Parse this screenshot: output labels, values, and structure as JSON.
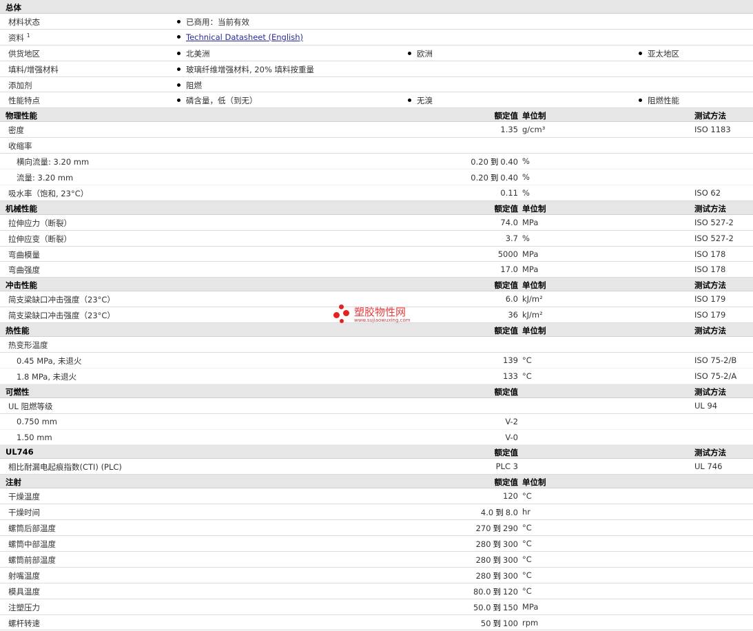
{
  "general": {
    "title": "总体",
    "material_status_label": "材料状态",
    "material_status_value": "已商用：当前有效",
    "docs_label": "资料",
    "docs_sup": "1",
    "docs_link": "Technical Datasheet (English)",
    "supply_label": "供货地区",
    "supply": [
      "北美洲",
      "欧洲",
      "亚太地区"
    ],
    "filler_label": "填料/增强材料",
    "filler_value": "玻璃纤维增强材料, 20% 填料按重量",
    "additive_label": "添加剂",
    "additive_value": "阻燃",
    "features_label": "性能特点",
    "features": [
      "磷含量，低（到无）",
      "无溴",
      "阻燃性能"
    ]
  },
  "headers": {
    "nominal": "额定值",
    "unit": "单位制",
    "test": "测试方法",
    "to": "到"
  },
  "physical": {
    "title": "物理性能",
    "rows": [
      {
        "label": "密度",
        "value": "1.35",
        "unit": "g/cm³",
        "test": "ISO 1183"
      },
      {
        "label": "收缩率"
      },
      {
        "label": "横向流量: 3.20 mm",
        "from": "0.20",
        "to": "0.40",
        "unit": "%"
      },
      {
        "label": "流量: 3.20 mm",
        "from": "0.20",
        "to": "0.40",
        "unit": "%"
      },
      {
        "label": "吸水率（饱和, 23°C）",
        "value": "0.11",
        "unit": "%",
        "test": "ISO 62"
      }
    ]
  },
  "mechanical": {
    "title": "机械性能",
    "rows": [
      {
        "label": "拉伸应力（断裂）",
        "value": "74.0",
        "unit": "MPa",
        "test": "ISO 527-2"
      },
      {
        "label": "拉伸应变（断裂）",
        "value": "3.7",
        "unit": "%",
        "test": "ISO 527-2"
      },
      {
        "label": "弯曲模量",
        "value": "5000",
        "unit": "MPa",
        "test": "ISO 178"
      },
      {
        "label": "弯曲强度",
        "value": "17.0",
        "unit": "MPa",
        "test": "ISO 178"
      }
    ]
  },
  "impact": {
    "title": "冲击性能",
    "rows": [
      {
        "label": "简支梁缺口冲击强度（23°C）",
        "value": "6.0",
        "unit": "kJ/m²",
        "test": "ISO 179"
      },
      {
        "label": "简支梁缺口冲击强度（23°C）",
        "value": "36",
        "unit": "kJ/m²",
        "test": "ISO 179"
      }
    ]
  },
  "thermal": {
    "title": "热性能",
    "rows": [
      {
        "label": "热变形温度"
      },
      {
        "label": "0.45 MPa, 未退火",
        "value": "139",
        "unit": "°C",
        "test": "ISO 75-2/B"
      },
      {
        "label": "1.8 MPa, 未退火",
        "value": "133",
        "unit": "°C",
        "test": "ISO 75-2/A"
      }
    ]
  },
  "flammability": {
    "title": "可燃性",
    "rows": [
      {
        "label": "UL 阻燃等级",
        "test": "UL 94"
      },
      {
        "label": "0.750 mm",
        "value": "V-2"
      },
      {
        "label": "1.50 mm",
        "value": "V-0"
      }
    ]
  },
  "ul746": {
    "title": "UL746",
    "rows": [
      {
        "label": "相比耐漏电起痕指数(CTI) (PLC)",
        "value": "PLC 3",
        "test": "UL 746"
      }
    ]
  },
  "injection": {
    "title": "注射",
    "rows": [
      {
        "label": "干燥温度",
        "value": "120",
        "unit": "°C"
      },
      {
        "label": "干燥时间",
        "from": "4.0",
        "to": "8.0",
        "unit": "hr"
      },
      {
        "label": "螺筒后部温度",
        "from": "270",
        "to": "290",
        "unit": "°C"
      },
      {
        "label": "螺筒中部温度",
        "from": "280",
        "to": "300",
        "unit": "°C"
      },
      {
        "label": "螺筒前部温度",
        "from": "280",
        "to": "300",
        "unit": "°C"
      },
      {
        "label": "射嘴温度",
        "from": "280",
        "to": "300",
        "unit": "°C"
      },
      {
        "label": "模具温度",
        "from": "80.0",
        "to": "120",
        "unit": "°C"
      },
      {
        "label": "注塑压力",
        "from": "50.0",
        "to": "150",
        "unit": "MPa"
      },
      {
        "label": "螺杆转速",
        "from": "50",
        "to": "100",
        "unit": "rpm"
      }
    ]
  },
  "watermark": {
    "text": "塑胶物性网",
    "url": "www.sujiaowuxing.com"
  }
}
